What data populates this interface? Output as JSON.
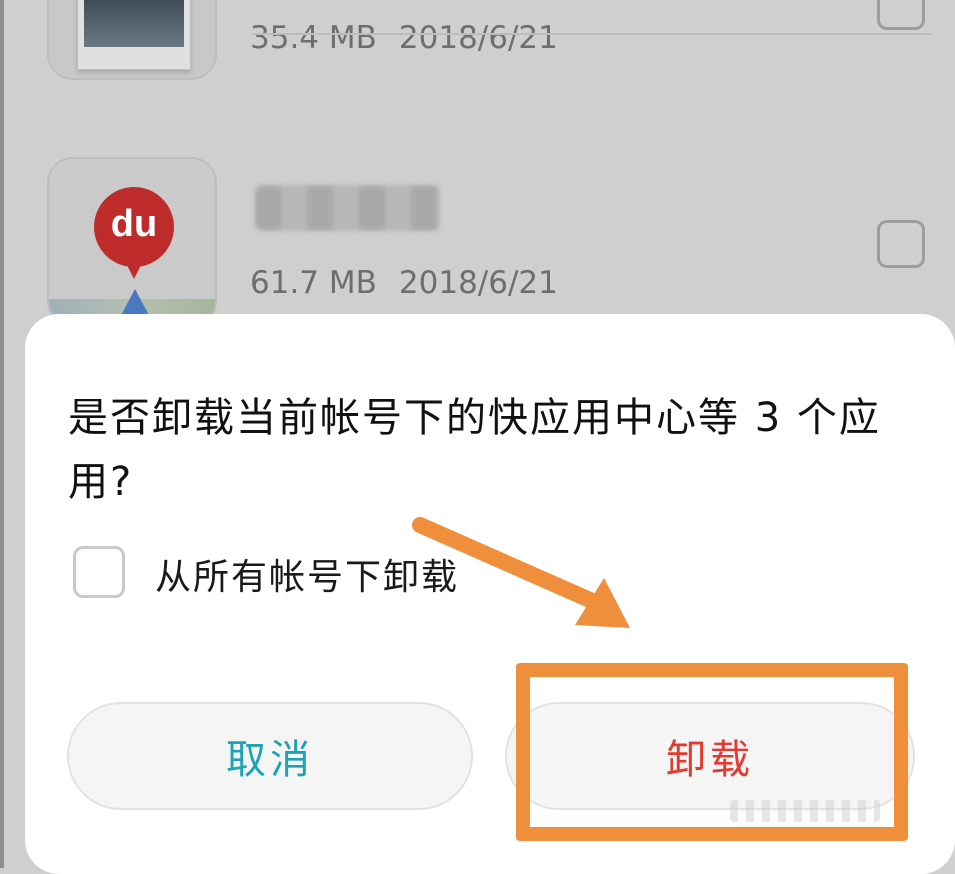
{
  "app_list": [
    {
      "size": "35.4 MB",
      "date": "2018/6/21",
      "icon": "photo-gallery-icon"
    },
    {
      "size": "61.7 MB",
      "date": "2018/6/21",
      "icon": "baidu-maps-icon",
      "icon_text": "du"
    }
  ],
  "dialog": {
    "title": "是否卸载当前帐号下的快应用中心等 3 个应用?",
    "checkbox_label": "从所有帐号下卸载",
    "cancel_label": "取消",
    "uninstall_label": "卸载"
  },
  "colors": {
    "cancel_text": "#1ea3b3",
    "uninstall_text": "#e33a2f",
    "annotation": "#ef8f3c"
  }
}
